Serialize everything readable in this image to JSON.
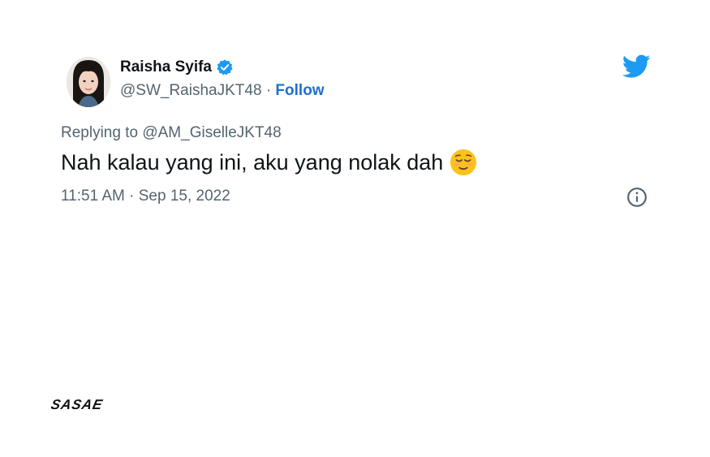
{
  "author": {
    "display_name": "Raisha Syifa",
    "handle": "@SW_RaishaJKT48",
    "separator": "·",
    "follow_label": "Follow",
    "verified": true
  },
  "tweet": {
    "reply_prefix": "Replying to",
    "reply_handle": "@AM_GiselleJKT48",
    "text": "Nah kalau yang ini, aku yang nolak dah",
    "emoji": "relieved-face-emoji",
    "timestamp": "11:51 AM · Sep 15, 2022"
  },
  "icons": {
    "logo": "twitter-bird-icon",
    "verified": "verified-badge-icon",
    "info": "info-icon"
  },
  "watermark": {
    "text": "SASAE"
  },
  "colors": {
    "twitter_blue": "#1d9bf0",
    "follow_blue": "#1d6fd1",
    "muted_text": "#536471",
    "primary_text": "#0f1419"
  }
}
